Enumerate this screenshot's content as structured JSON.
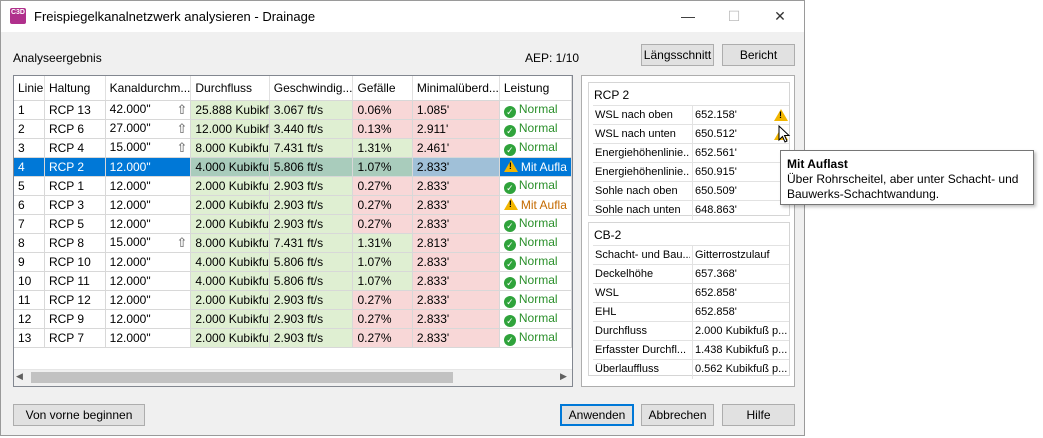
{
  "window": {
    "icon_text": "C3D",
    "title": "Freispiegelkanalnetzwerk analysieren - Drainage",
    "minimize": "—",
    "maximize": "☐",
    "close": "✕"
  },
  "header": {
    "section_label": "Analyseergebnis",
    "aep": "AEP: 1/10",
    "profile_button": "Längsschnitt",
    "report_button": "Bericht"
  },
  "grid": {
    "columns": [
      "Linie",
      "Haltung",
      "Kanaldurchm...",
      "Durchfluss",
      "Geschwindig...",
      "Gefälle",
      "Minimalüberd...",
      "Leistung"
    ],
    "rows": [
      {
        "linie": "1",
        "haltung": "RCP 13",
        "durchm": "42.000\"",
        "arrow": true,
        "durchfluss": "25.888 Kubikf",
        "geschw": "3.067 ft/s",
        "gefaelle": "0.06%",
        "gefaelle_status": "bad",
        "minimal": "1.085'",
        "leistung": "Normal",
        "status": "ok"
      },
      {
        "linie": "2",
        "haltung": "RCP 6",
        "durchm": "27.000\"",
        "arrow": true,
        "durchfluss": "12.000 Kubikf",
        "geschw": "3.440 ft/s",
        "gefaelle": "0.13%",
        "gefaelle_status": "bad",
        "minimal": "2.911'",
        "leistung": "Normal",
        "status": "ok"
      },
      {
        "linie": "3",
        "haltung": "RCP 4",
        "durchm": "15.000\"",
        "arrow": true,
        "durchfluss": "8.000 Kubikfu",
        "geschw": "7.431 ft/s",
        "gefaelle": "1.31%",
        "gefaelle_status": "good",
        "minimal": "2.461'",
        "leistung": "Normal",
        "status": "ok"
      },
      {
        "linie": "4",
        "haltung": "RCP 2",
        "durchm": "12.000\"",
        "arrow": false,
        "durchfluss": "4.000 Kubikfu",
        "geschw": "5.806 ft/s",
        "gefaelle": "1.07%",
        "gefaelle_status": "good",
        "minimal": "2.833'",
        "leistung": "Mit Aufla",
        "status": "warn",
        "selected": true
      },
      {
        "linie": "5",
        "haltung": "RCP 1",
        "durchm": "12.000\"",
        "arrow": false,
        "durchfluss": "2.000 Kubikfu",
        "geschw": "2.903 ft/s",
        "gefaelle": "0.27%",
        "gefaelle_status": "bad",
        "minimal": "2.833'",
        "leistung": "Normal",
        "status": "ok"
      },
      {
        "linie": "6",
        "haltung": "RCP 3",
        "durchm": "12.000\"",
        "arrow": false,
        "durchfluss": "2.000 Kubikfu",
        "geschw": "2.903 ft/s",
        "gefaelle": "0.27%",
        "gefaelle_status": "bad",
        "minimal": "2.833'",
        "leistung": "Mit Aufla",
        "status": "warn"
      },
      {
        "linie": "7",
        "haltung": "RCP 5",
        "durchm": "12.000\"",
        "arrow": false,
        "durchfluss": "2.000 Kubikfu",
        "geschw": "2.903 ft/s",
        "gefaelle": "0.27%",
        "gefaelle_status": "bad",
        "minimal": "2.833'",
        "leistung": "Normal",
        "status": "ok"
      },
      {
        "linie": "8",
        "haltung": "RCP 8",
        "durchm": "15.000\"",
        "arrow": true,
        "durchfluss": "8.000 Kubikfu",
        "geschw": "7.431 ft/s",
        "gefaelle": "1.31%",
        "gefaelle_status": "good",
        "minimal": "2.813'",
        "leistung": "Normal",
        "status": "ok"
      },
      {
        "linie": "9",
        "haltung": "RCP 10",
        "durchm": "12.000\"",
        "arrow": false,
        "durchfluss": "4.000 Kubikfu",
        "geschw": "5.806 ft/s",
        "gefaelle": "1.07%",
        "gefaelle_status": "good",
        "minimal": "2.833'",
        "leistung": "Normal",
        "status": "ok"
      },
      {
        "linie": "10",
        "haltung": "RCP 11",
        "durchm": "12.000\"",
        "arrow": false,
        "durchfluss": "4.000 Kubikfu",
        "geschw": "5.806 ft/s",
        "gefaelle": "1.07%",
        "gefaelle_status": "good",
        "minimal": "2.833'",
        "leistung": "Normal",
        "status": "ok"
      },
      {
        "linie": "11",
        "haltung": "RCP 12",
        "durchm": "12.000\"",
        "arrow": false,
        "durchfluss": "2.000 Kubikfu",
        "geschw": "2.903 ft/s",
        "gefaelle": "0.27%",
        "gefaelle_status": "bad",
        "minimal": "2.833'",
        "leistung": "Normal",
        "status": "ok"
      },
      {
        "linie": "12",
        "haltung": "RCP 9",
        "durchm": "12.000\"",
        "arrow": false,
        "durchfluss": "2.000 Kubikfu",
        "geschw": "2.903 ft/s",
        "gefaelle": "0.27%",
        "gefaelle_status": "bad",
        "minimal": "2.833'",
        "leistung": "Normal",
        "status": "ok"
      },
      {
        "linie": "13",
        "haltung": "RCP 7",
        "durchm": "12.000\"",
        "arrow": false,
        "durchfluss": "2.000 Kubikfu",
        "geschw": "2.903 ft/s",
        "gefaelle": "0.27%",
        "gefaelle_status": "bad",
        "minimal": "2.833'",
        "leistung": "Normal",
        "status": "ok"
      }
    ]
  },
  "pipe_panel": {
    "title": "RCP 2",
    "rows": [
      {
        "k": "WSL nach oben",
        "v": "652.158'",
        "warn": true
      },
      {
        "k": "WSL nach unten",
        "v": "650.512'",
        "warn": true
      },
      {
        "k": "Energiehöhenlinie...",
        "v": "652.561'",
        "warn": false
      },
      {
        "k": "Energiehöhenlinie...",
        "v": "650.915'",
        "warn": false
      },
      {
        "k": "Sohle nach oben",
        "v": "650.509'",
        "warn": false
      },
      {
        "k": "Sohle nach unten",
        "v": "648.863'",
        "warn": false
      }
    ]
  },
  "structure_panel": {
    "title": "CB-2",
    "rows": [
      {
        "k": "Schacht- und Bau...",
        "v": "Gitterrostzulauf"
      },
      {
        "k": "Deckelhöhe",
        "v": "657.368'"
      },
      {
        "k": "WSL",
        "v": "652.858'"
      },
      {
        "k": "EHL",
        "v": "652.858'"
      },
      {
        "k": "Durchfluss",
        "v": "2.000 Kubikfuß p..."
      },
      {
        "k": "Erfasster Durchfl...",
        "v": "1.438 Kubikfuß p..."
      },
      {
        "k": "Überlauffluss",
        "v": "0.562 Kubikfuß p..."
      }
    ]
  },
  "tooltip": {
    "title": "Mit Auflast",
    "text": "Über Rohrscheitel, aber unter Schacht- und Bauwerks-Schachtwandung."
  },
  "footer": {
    "restart_button": "Von vorne beginnen",
    "apply_button": "Anwenden",
    "cancel_button": "Abbrechen",
    "help_button": "Hilfe"
  },
  "colors": {
    "selection": "#0078d7",
    "good": "#dfefd2",
    "bad": "#f8d7d7",
    "ok_icon": "#2fa33b",
    "warn_icon": "#f2b600"
  }
}
